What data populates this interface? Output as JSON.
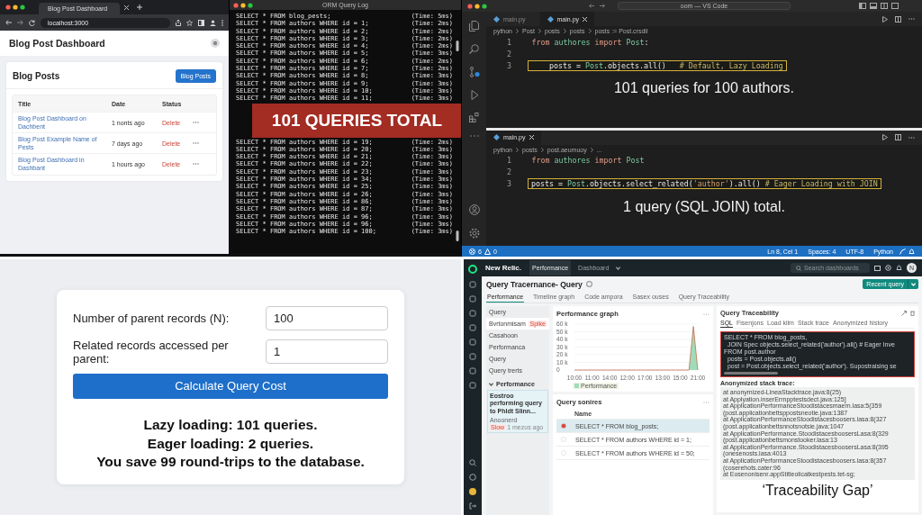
{
  "browser": {
    "tab_title": "Blog Post Dashboard",
    "url": "localhost:3000",
    "page_title": "Blog Post Dashboard",
    "card_title": "Blog Posts",
    "card_button": "Blog Posts",
    "columns": [
      "Title",
      "Date",
      "Status"
    ],
    "rows": [
      {
        "title": "Blog Post Dashboard on Dachbent",
        "date": "1 nonts ago",
        "action": "Delete"
      },
      {
        "title": "Blog Post Example Name of Pests",
        "date": "7 days ago",
        "action": "Delete"
      },
      {
        "title": "Blog Post Dashboard in Dashbant",
        "date": "1 hours ago",
        "action": "Delete"
      }
    ]
  },
  "orm_log": {
    "title": "ORM Query Log",
    "rows_above": [
      {
        "query": "SELECT * FROM blog_pests;",
        "time": "(Time: 5ms)"
      },
      {
        "query": "SELECT * FROM authors WHERE id = 1;",
        "time": "(Time: 2ms)"
      },
      {
        "query": "SELECT * FROM authors WHERE id = 2;",
        "time": "(Time: 2ms)"
      },
      {
        "query": "SELECT * FROM authors WHERE id = 3;",
        "time": "(Time: 2ms)"
      },
      {
        "query": "SELECT * FROM authors WHERE id = 4;",
        "time": "(Time: 2ms)"
      },
      {
        "query": "SELECT * FROM authors WHERE id = 5;",
        "time": "(Time: 3ms)"
      },
      {
        "query": "SELECT * FROM authors WHERE id = 6;",
        "time": "(Time: 2ms)"
      },
      {
        "query": "SELECT * FROM authors WHERE id = 7;",
        "time": "(Time: 2ms)"
      },
      {
        "query": "SELECT * FROM authors WHERE id = 8;",
        "time": "(Time: 3ms)"
      },
      {
        "query": "SELECT * FROM authors WHERE id = 9;",
        "time": "(Time: 3ms)"
      },
      {
        "query": "SELECT * FROM authors WHERE id = 10;",
        "time": "(Time: 3ms)"
      },
      {
        "query": "SELECT * FROM authors WHERE id = 11;",
        "time": "(Time: 3ms)"
      }
    ],
    "banner": "101 QUERIES TOTAL",
    "rows_below": [
      {
        "query": "SELECT * FROM authors WHERE id = 19;",
        "time": "(Time: 2ms)"
      },
      {
        "query": "SELECT * FROM authors WHERE id = 20;",
        "time": "(Time: 3ms)"
      },
      {
        "query": "SELECT * FROM authors WHERE id = 21;",
        "time": "(Time: 3ms)"
      },
      {
        "query": "SELECT * FROM authors WHERE id = 22;",
        "time": "(Time: 3ms)"
      },
      {
        "query": "SELECT * FROM authors WHERE id = 23;",
        "time": "(Time: 3ms)"
      },
      {
        "query": "SELECT * FROM authors WHERE id = 34;",
        "time": "(Time: 3ms)"
      },
      {
        "query": "SELECT * FROM authors WHERE id = 25;",
        "time": "(Time: 3ms)"
      },
      {
        "query": "SELECT * FROM authors WHERE id = 26;",
        "time": "(Time: 3ms)"
      },
      {
        "query": "SELECT * FROM authors WHERE id = 86;",
        "time": "(Time: 3ms)"
      },
      {
        "query": "SELECT * FROM authors WHERE id = 87;",
        "time": "(Time: 3ms)"
      },
      {
        "query": "SELECT * FROM authors WHERE id = 96;",
        "time": "(Time: 3ms)"
      },
      {
        "query": "SELECT * FROM authors WHERE id = 96;",
        "time": "(Time: 3ms)"
      },
      {
        "query": "SELECT * FROM authors WHERE id = 100;",
        "time": "(Time: 3ms)"
      }
    ]
  },
  "vscode": {
    "title": "oom — VS Code",
    "panes": [
      {
        "tabs": [
          {
            "label": "main.py",
            "selected": false
          },
          {
            "label": "main.py",
            "selected": true
          }
        ],
        "breadcrumbs": [
          "python",
          "Post",
          "posts",
          "posts",
          "posts := Post.crsdil"
        ],
        "lines": [
          {
            "number": "1",
            "boxed": false,
            "tokens": [
              {
                "kind": "keyword",
                "text": "from "
              },
              {
                "kind": "name",
                "text": "authores "
              },
              {
                "kind": "keyword",
                "text": "import "
              },
              {
                "kind": "name",
                "text": "Post"
              },
              {
                "kind": "plain",
                "text": ":"
              }
            ]
          },
          {
            "number": "2",
            "boxed": false
          },
          {
            "number": "3",
            "boxed": true,
            "tokens": [
              {
                "kind": "plain",
                "text": "    posts = "
              },
              {
                "kind": "name",
                "text": "Post"
              },
              {
                "kind": "plain",
                "text": ".objects.all()   "
              },
              {
                "kind": "comment",
                "text": "# Default, Lazy Loading"
              }
            ]
          }
        ],
        "caption": "101 queries for 100 authors."
      },
      {
        "tabs": [
          {
            "label": "main.py",
            "selected": true
          }
        ],
        "breadcrumbs": [
          "python",
          "posts",
          "post.aeumuoy",
          "..."
        ],
        "lines": [
          {
            "number": "1",
            "boxed": false,
            "tokens": [
              {
                "kind": "keyword",
                "text": "from "
              },
              {
                "kind": "name",
                "text": "authores "
              },
              {
                "kind": "keyword",
                "text": "import "
              },
              {
                "kind": "name",
                "text": "Post"
              }
            ]
          },
          {
            "number": "2",
            "boxed": false
          },
          {
            "number": "3",
            "boxed": true,
            "tokens": [
              {
                "kind": "plain",
                "text": "posts = "
              },
              {
                "kind": "name",
                "text": "Post"
              },
              {
                "kind": "plain",
                "text": ".objects.select_related("
              },
              {
                "kind": "string",
                "text": "'author'"
              },
              {
                "kind": "plain",
                "text": ").all() "
              },
              {
                "kind": "comment",
                "text": "# Eager Loading with JOIN"
              }
            ]
          }
        ],
        "caption": "1 query (SQL JOIN) total."
      }
    ],
    "status": {
      "errors": "6",
      "warnings": "0",
      "items": [
        "Ln 8, Cel 1",
        "Spaces: 4",
        "UTF-8",
        "Python"
      ]
    }
  },
  "calculator": {
    "fields": [
      {
        "label": "Number of parent records (N):",
        "value": "100"
      },
      {
        "label": "Related records accessed per parent:",
        "value": "1"
      }
    ],
    "button": "Calculate Query Cost",
    "results": [
      "**Lazy loading:** 101 queries.",
      "**Eager loading:** 2 queries.",
      "You save 99 round-trips to the database."
    ]
  },
  "new_relic": {
    "brand": "New Relic.",
    "nav_tabs": [
      {
        "label": "Performance",
        "selected": true
      },
      {
        "label": "Dashboard",
        "selected": false
      }
    ],
    "search_placeholder": "Search dashboards",
    "avatar": "N",
    "page_title": "Query Tracernance- Query",
    "primary_button": "Recent query",
    "tabs": [
      {
        "label": "Performance",
        "selected": true
      },
      {
        "label": "Timeline graph",
        "selected": false
      },
      {
        "label": "Code ampora",
        "selected": false
      },
      {
        "label": "Sasex ouses",
        "selected": false
      },
      {
        "label": "Query Traceability",
        "selected": false
      }
    ],
    "side_items": [
      {
        "label": "Query",
        "selected": false
      },
      {
        "label": "Bvrtonmisam",
        "selected": true,
        "badge": "Spike"
      },
      {
        "label": "Casahoon",
        "selected": false
      },
      {
        "label": "Performanca",
        "selected": false
      },
      {
        "label": "Query",
        "selected": false
      },
      {
        "label": "Query trerts",
        "selected": false
      }
    ],
    "side_section": {
      "label": "Performance",
      "expanded": true,
      "card": {
        "title": "Eostroo performing query to Phldt Slinn...",
        "subtitle": "Anoonerd",
        "badge": "Slow",
        "time": "1 mezos ago"
      }
    },
    "graph_card": {
      "title": "Performance graph",
      "chart_data": {
        "type": "area",
        "categories": [
          "10:00",
          null,
          null,
          null,
          "11:00",
          null,
          null,
          null,
          "14:00",
          null,
          null,
          null,
          "12:00",
          null,
          null,
          null,
          "17:00",
          null,
          null,
          null,
          "13:00",
          null,
          null,
          null,
          "15:00",
          null,
          null,
          null,
          "21:00"
        ],
        "ylim": [
          0,
          60000
        ],
        "grid": true,
        "yticks": [
          {
            "value": 0,
            "label": "0"
          },
          {
            "value": 10000,
            "label": "10 k"
          },
          {
            "value": 20000,
            "label": "20 k"
          },
          {
            "value": 30000,
            "label": "30 k"
          },
          {
            "value": 40000,
            "label": "40 k"
          },
          {
            "value": 50000,
            "label": "50 k"
          },
          {
            "value": 60000,
            "label": "60 k"
          }
        ],
        "series": [
          {
            "name": "Performance",
            "color": "#9fdcb8",
            "values": [
              0,
              0,
              0,
              0,
              0,
              0,
              0,
              0,
              0,
              0,
              0,
              0,
              0,
              0,
              0,
              0,
              0,
              0,
              0,
              0,
              0,
              0,
              0,
              0,
              0,
              0,
              0,
              57000,
              0
            ]
          }
        ]
      }
    },
    "sources_card": {
      "title": "Query sonires",
      "column": "Name",
      "rows": [
        {
          "query": "SELECT * FROM blog_posts;",
          "selected": true
        },
        {
          "query": "SELECT * FROM authors WHERE id = 1;",
          "selected": false
        },
        {
          "query": "SELECT * FROM authors WHERE id = 50;",
          "selected": false
        }
      ]
    },
    "traceability": {
      "title": "Query Traceability",
      "tabs": [
        {
          "label": "SQL",
          "selected": true
        },
        {
          "label": "Fisenjons",
          "selected": false
        },
        {
          "label": "Load kilm",
          "selected": false
        },
        {
          "label": "Stack trace",
          "selected": false
        },
        {
          "label": "Anonymized history",
          "selected": false
        }
      ],
      "code": [
        "SELECT * FROM blog_posts,",
        "  JOIN Spec objects.select_related('author').all() # Eager Inve",
        "FROM post.author",
        "  posts = Post.objects.all()",
        "  post = Post.objects.select_related('author'). Supostraising se"
      ],
      "stack_title": "Anonymized stack trace:",
      "stack": [
        "at anonymized-LineaStacktrace.java:8(25)",
        "at Applyation.inserErrnpptestsdect.java:125]",
        "at ApplicationPerformanceStoodistacesmaern.lasa:5(359",
        "(post.applicationbettsppostsneotie.java:1387",
        "at ApplicationPerformanceStoodistacesboosers.lasa:8(327",
        "(post.applicationbettsnnotsnotsie.java:1047",
        "at ApplicationPerformance.StoodistacesboosersLasa:8(329",
        "(post.applicationbettsmonstooker.lasa:13",
        "at ApplicationPerformance.StoodistacesboosersLasa:8(395",
        "(onesenosts.lasa:4013",
        "at ApplicationPerformanceStoodistacesboosers.lasa:8(357",
        "(coserehots.cater:96",
        "at Eosenonisenr.appStitleolicatkestpests.tet-sg;"
      ],
      "caption": "‘Traceability Gap’"
    }
  }
}
